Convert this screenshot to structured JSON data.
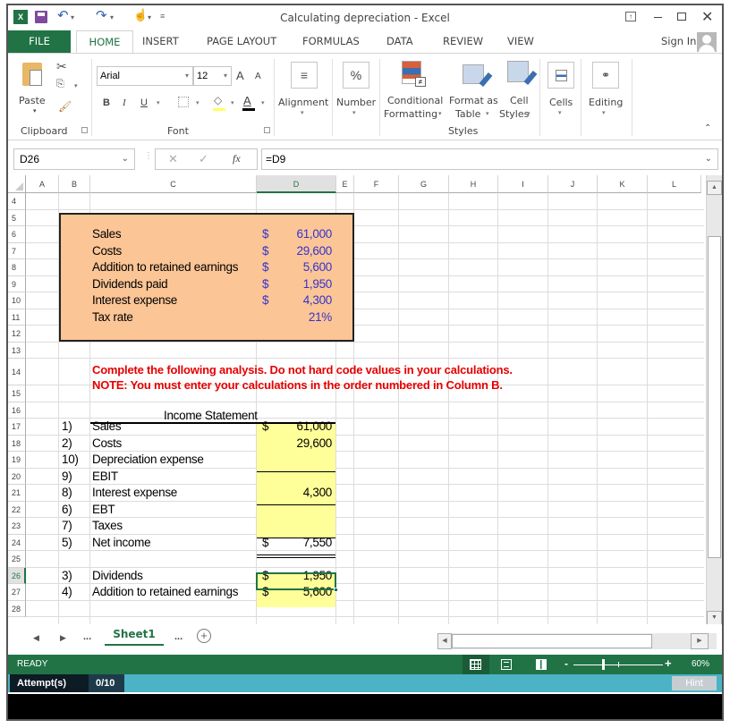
{
  "window": {
    "title": "Calculating depreciation - Excel",
    "controls": [
      "ribbon-display-icon",
      "minimize-icon",
      "restore-icon",
      "close-icon"
    ]
  },
  "quick_access": {
    "icons": [
      "excel-logo-icon",
      "save-icon",
      "undo-icon",
      "redo-icon",
      "touch-mode-icon",
      "customize-icon"
    ]
  },
  "tabs": {
    "items": [
      "FILE",
      "HOME",
      "INSERT",
      "PAGE LAYOUT",
      "FORMULAS",
      "DATA",
      "REVIEW",
      "VIEW"
    ],
    "active": "HOME",
    "sign_in": "Sign In"
  },
  "ribbon": {
    "clipboard": {
      "paste": "Paste",
      "group": "Clipboard"
    },
    "font": {
      "name": "Arial",
      "size": "12",
      "bold": "B",
      "italic": "I",
      "underline": "U",
      "group": "Font",
      "grow": "A",
      "shrink": "A",
      "font_color_letter": "A"
    },
    "alignment": {
      "label": "Alignment"
    },
    "number": {
      "label": "Number",
      "icon_text": "%"
    },
    "styles": {
      "conditional_1": "Conditional",
      "conditional_2": "Formatting",
      "format_table_1": "Format as",
      "format_table_2": "Table",
      "cell_styles_1": "Cell",
      "cell_styles_2": "Styles",
      "group": "Styles"
    },
    "cells": {
      "label": "Cells"
    },
    "editing": {
      "label": "Editing"
    },
    "colors": {
      "fill_color": "#ffff66",
      "font_color": "#000000"
    }
  },
  "formula_bar": {
    "name_box": "D26",
    "cancel": "✕",
    "enter": "✓",
    "fx": "fx",
    "formula": "=D9"
  },
  "grid": {
    "columns": [
      "A",
      "B",
      "C",
      "D",
      "E",
      "F",
      "G",
      "H",
      "I",
      "J",
      "K",
      "L"
    ],
    "selected_column": "D",
    "rows": [
      "4",
      "5",
      "6",
      "7",
      "8",
      "9",
      "10",
      "11",
      "12",
      "13",
      "14",
      "15",
      "16",
      "17",
      "18",
      "19",
      "20",
      "21",
      "22",
      "23",
      "24",
      "25",
      "26",
      "27",
      "28"
    ],
    "selected_row": "26",
    "given_data": [
      {
        "label": "Sales",
        "currency": "$",
        "value": "61,000"
      },
      {
        "label": "Costs",
        "currency": "$",
        "value": "29,600"
      },
      {
        "label": "Addition to retained earnings",
        "currency": "$",
        "value": "5,600"
      },
      {
        "label": "Dividends paid",
        "currency": "$",
        "value": "1,950"
      },
      {
        "label": "Interest expense",
        "currency": "$",
        "value": "4,300"
      },
      {
        "label": "Tax rate",
        "currency": "",
        "value": "21%"
      }
    ],
    "instructions": [
      "Complete the following analysis. Do not hard code values in your calculations.",
      "NOTE: You must enter your calculations in the order numbered in Column B."
    ],
    "income_statement": {
      "title": "Income Statement",
      "lines": [
        {
          "num": "1)",
          "label": "Sales",
          "currency": "$",
          "value": "61,000"
        },
        {
          "num": "2)",
          "label": "Costs",
          "currency": "",
          "value": "29,600"
        },
        {
          "num": "10)",
          "label": "Depreciation expense",
          "currency": "",
          "value": ""
        },
        {
          "num": "9)",
          "label": "EBIT",
          "currency": "",
          "value": ""
        },
        {
          "num": "8)",
          "label": "Interest expense",
          "currency": "",
          "value": "4,300"
        },
        {
          "num": "6)",
          "label": "EBT",
          "currency": "",
          "value": ""
        },
        {
          "num": "7)",
          "label": "Taxes",
          "currency": "",
          "value": ""
        },
        {
          "num": "5)",
          "label": "Net income",
          "currency": "$",
          "value": "7,550"
        }
      ],
      "extra": [
        {
          "num": "3)",
          "label": "Dividends",
          "currency": "$",
          "value": "1,950"
        },
        {
          "num": "4)",
          "label": "Addition to retained earnings",
          "currency": "$",
          "value": "5,600"
        }
      ]
    },
    "colors": {
      "given_box": "#fcc596",
      "answer_cells": "#ffff99",
      "instruction_text": "#e60000",
      "value_text": "#3333cc"
    }
  },
  "sheets": {
    "nav_prev": "◀",
    "nav_next": "▶",
    "ellipsis_left": "...",
    "active_sheet": "Sheet1",
    "ellipsis_right": "...",
    "add": "+"
  },
  "status": {
    "ready": "READY",
    "zoom": "60%",
    "zoom_minus": "-",
    "zoom_plus": "+"
  },
  "attempts": {
    "label": "Attempt(s)",
    "value": "0/10",
    "hint": "Hint"
  }
}
